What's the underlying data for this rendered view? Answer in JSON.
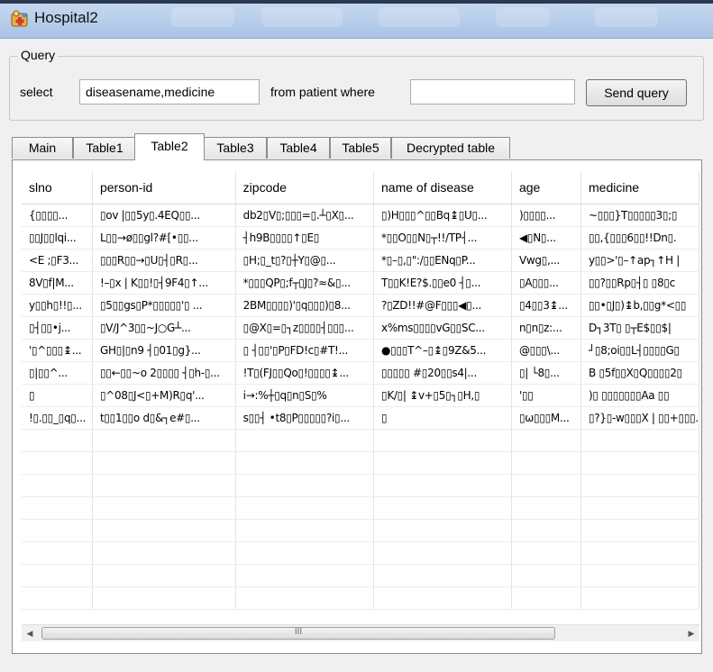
{
  "window": {
    "title": "Hospital2"
  },
  "query": {
    "group_label": "Query",
    "select_label": "select",
    "select_value": "diseasename,medicine",
    "from_label": "from patient where",
    "where_value": "",
    "send_label": "Send query"
  },
  "tabs": [
    {
      "label": "Main"
    },
    {
      "label": "Table1"
    },
    {
      "label": "Table2"
    },
    {
      "label": "Table3"
    },
    {
      "label": "Table4"
    },
    {
      "label": "Table5"
    },
    {
      "label": "Decrypted table"
    }
  ],
  "active_tab": "Table2",
  "table": {
    "columns": [
      "slno",
      "person-id",
      "zipcode",
      "name of disease",
      "age",
      "medicine"
    ],
    "rows": [
      [
        "{▯▯▯▯...",
        "▯ov |▯▯5y▯.4EQ▯▯...",
        "db2▯V▯;▯▯▯=▯.┴▯X▯...",
        "▯)H▯▯▯^▯▯Bq↨▯U▯...",
        ")▯▯▯▯...",
        "~▯▯▯}T▯▯▯▯▯3▯;▯"
      ],
      [
        "▯▯J▯▯lqi...",
        "L▯▯→ø▯▯gl?#[•▯▯...",
        "┤h9B▯▯▯▯↑▯E▯",
        "*▯▯O▯▯N▯┬!!/TP┤...",
        "◀▯N▯...",
        "▯▯,{▯▯▯6▯▯!!Dn▯."
      ],
      [
        "<E ;▯F3...",
        "▯▯▯R▯▯→▯U▯┤▯R▯...",
        "▯H;▯_t▯?▯┼Y▯@▯...",
        "*▯–▯,▯\":/▯▯ENq▯P...",
        "Vwg▯,...",
        "y▯▯>'▯–↑ap┐↑H |"
      ],
      [
        "8V▯f|M...",
        "!–▯x | K▯▯!▯┤9F4▯↑...",
        "*▯▯▯QP▯;f┬▯J▯?≈&▯...",
        "T▯▯K!E?$.▯▯e0 ┤▯...",
        "▯A▯▯▯...",
        "▯▯?▯▯Rp▯┤▯ ▯8▯c"
      ],
      [
        "y▯▯h▯!!▯...",
        "▯5▯▯gs▯P*▯▯▯▯▯'▯ ...",
        "2BM▯▯▯▯)'▯q▯▯▯)▯8...",
        "?▯ZD!!#@F▯▯▯◀▯...",
        "▯4▯▯3↨...",
        "▯▯•▯J▯)↨b,▯▯g*<▯▯"
      ],
      [
        "▯┤▯▯•j...",
        "▯V/J^3▯▯~J○G┴...",
        "▯@X▯=▯┐z▯▯▯▯┤▯▯▯...",
        "x%ms▯▯▯▯vG▯▯SC...",
        "n▯n▯z:...",
        "D┐3T▯ ▯┬E$▯▯$|"
      ],
      [
        "'▯^▯▯▯↨...",
        "GH▯|▯n9 ┤▯01▯g}...",
        "▯ ┤▯▯'▯P▯FD!c▯#T!...",
        "●▯▯▯T^–▯↨▯9Z&5...",
        "@▯▯▯\\...",
        "┘▯8;oi▯▯L┤▯▯▯▯G▯"
      ],
      [
        "▯|▯▯^...",
        "▯▯←▯▯~o 2▯▯▯▯ ┤▯h-▯...",
        "!T▯(FJ▯▯Qo▯!▯▯▯▯↨...",
        "▯▯▯▯▯ #▯20▯▯s4|...",
        "▯| └8▯...",
        "B ▯5f▯▯X▯Q▯▯▯▯2▯"
      ],
      [
        "▯",
        "▯^08▯J<▯+M)R▯q'...",
        "i→:%┼▯q▯n▯S▯%",
        "▯K/▯| ↨v+▯5▯┐▯H,▯",
        "'▯▯",
        ")▯ ▯▯▯▯▯▯▯Aa ▯▯"
      ],
      [
        "!▯.▯▯_▯q▯...",
        "t▯▯1▯▯o  d▯&┐e#▯...",
        "s▯▯┤ •t8▯P▯▯▯▯▯?i▯...",
        "▯",
        "▯ω▯▯▯M...",
        "▯?}▯-w▯▯▯X | ▯▯+▯▯▯."
      ]
    ]
  },
  "colors": {
    "titlebar": "#bcd1ec",
    "window_bg": "#f0f0f0"
  },
  "icons": {
    "app": "medical-app-icon",
    "scroll_left": "arrow-left-icon",
    "scroll_right": "arrow-right-icon"
  },
  "scrollbar": {
    "thumb_grip": "III"
  }
}
